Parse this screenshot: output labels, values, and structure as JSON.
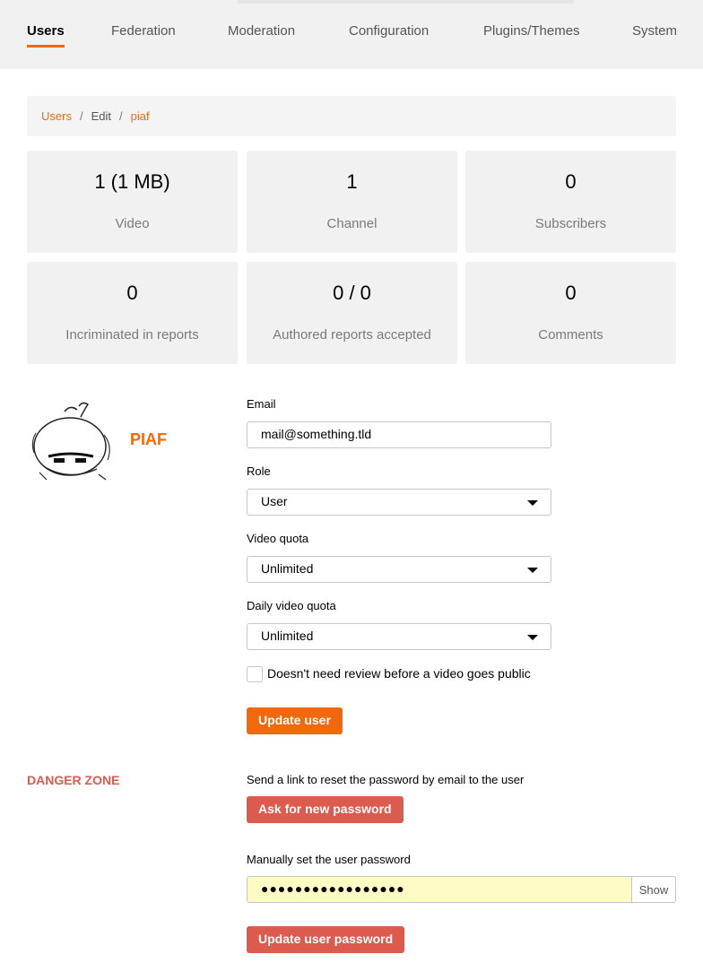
{
  "nav": {
    "tabs": [
      {
        "label": "Users",
        "active": true
      },
      {
        "label": "Federation",
        "active": false
      },
      {
        "label": "Moderation",
        "active": false
      },
      {
        "label": "Configuration",
        "active": false
      },
      {
        "label": "Plugins/Themes",
        "active": false
      },
      {
        "label": "System",
        "active": false
      }
    ]
  },
  "breadcrumb": {
    "items": [
      "Users",
      "Edit",
      "piaf"
    ],
    "separator": "/"
  },
  "stats": [
    {
      "value": "1 (1 MB)",
      "label": "Video"
    },
    {
      "value": "1",
      "label": "Channel"
    },
    {
      "value": "0",
      "label": "Subscribers"
    },
    {
      "value": "0",
      "label": "Incriminated in reports"
    },
    {
      "value": "0 / 0",
      "label": "Authored reports accepted"
    },
    {
      "value": "0",
      "label": "Comments"
    }
  ],
  "user": {
    "display_name": "PIAF"
  },
  "form": {
    "email_label": "Email",
    "email_value": "mail@something.tld",
    "role_label": "Role",
    "role_value": "User",
    "video_quota_label": "Video quota",
    "video_quota_value": "Unlimited",
    "daily_quota_label": "Daily video quota",
    "daily_quota_value": "Unlimited",
    "review_checkbox_label": "Doesn't need review before a video goes public",
    "review_checked": false,
    "update_button": "Update user"
  },
  "danger": {
    "title": "DANGER ZONE",
    "reset_text": "Send a link to reset the password by email to the user",
    "reset_button": "Ask for new password",
    "manual_text": "Manually set the user password",
    "password_mask": "●●●●●●●●●●●●●●●●●",
    "show_button": "Show",
    "update_password_button": "Update user password"
  },
  "colors": {
    "accent": "#f2690d",
    "danger": "#dd5a4e",
    "nav_bg": "#f1f1f1",
    "card_bg": "#f1f1f1",
    "password_bg": "#fcfcc4"
  }
}
